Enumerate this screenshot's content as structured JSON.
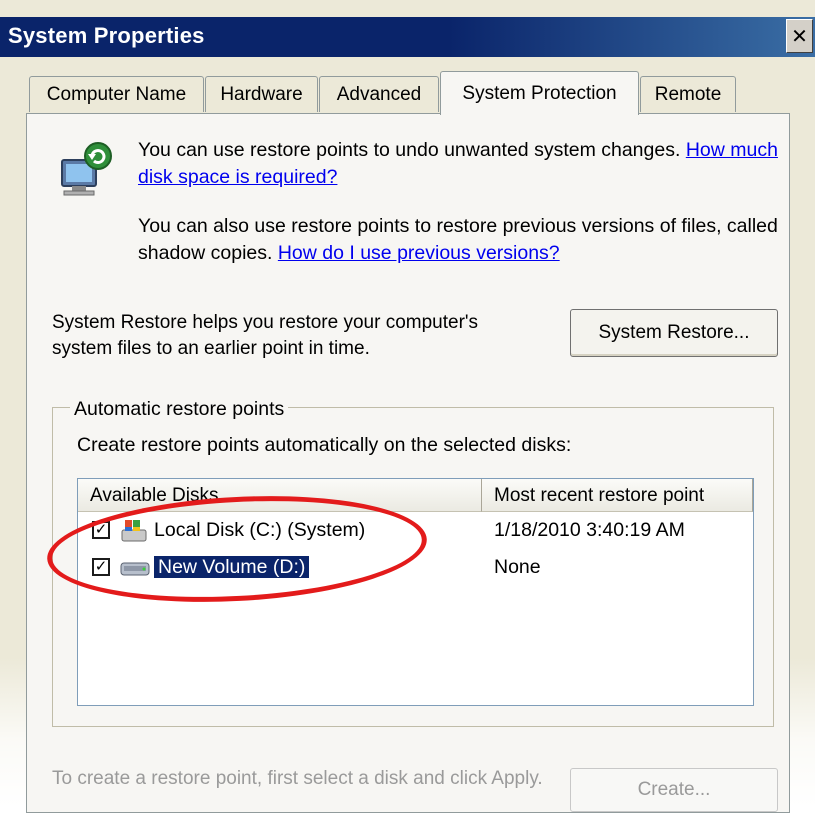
{
  "window": {
    "title": "System Properties",
    "close_glyph": "✕"
  },
  "tabs": [
    {
      "label": "Computer Name",
      "active": false
    },
    {
      "label": "Hardware",
      "active": false
    },
    {
      "label": "Advanced",
      "active": false
    },
    {
      "label": "System Protection",
      "active": true
    },
    {
      "label": "Remote",
      "active": false
    }
  ],
  "intro": {
    "icon": "system-restore-icon",
    "text1": "You can use restore points to undo unwanted system changes.",
    "link1": "How much disk space is required?",
    "text2": "You can also use restore points to restore previous versions of files, called shadow copies.",
    "link2": "How do I use previous versions?"
  },
  "system_restore": {
    "description": "System Restore helps you restore your computer's system files to an earlier point in time.",
    "button_label": "System Restore..."
  },
  "auto_restore": {
    "group_title": "Automatic restore points",
    "instruction": "Create restore points automatically on the selected disks:",
    "columns": [
      "Available Disks",
      "Most recent restore point"
    ],
    "rows": [
      {
        "checked": true,
        "icon": "system-drive-icon",
        "disk": "Local Disk (C:) (System)",
        "last_point": "1/18/2010 3:40:19 AM",
        "selected": false
      },
      {
        "checked": true,
        "icon": "drive-icon",
        "disk": "New Volume (D:)",
        "last_point": "None",
        "selected": true
      }
    ]
  },
  "footer": {
    "text": "To create a restore point, first select a disk and click Apply.",
    "create_button": "Create..."
  },
  "colors": {
    "accent": "#0a246a",
    "annotation": "#e31b1b",
    "link": "#0000ee"
  }
}
